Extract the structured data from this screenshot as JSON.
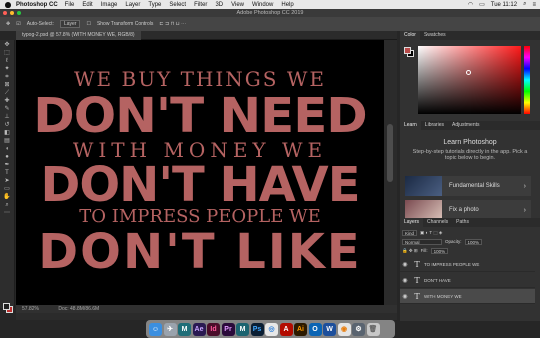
{
  "menubar": {
    "app": "Photoshop CC",
    "items": [
      "File",
      "Edit",
      "Image",
      "Layer",
      "Type",
      "Select",
      "Filter",
      "3D",
      "View",
      "Window",
      "Help"
    ],
    "time": "Tue 11:12"
  },
  "window": {
    "title": "Adobe Photoshop CC 2019"
  },
  "options": {
    "auto_select": "Auto-Select:",
    "layer_select": "Layer",
    "transform": "Show Transform Controls"
  },
  "document": {
    "tab": "typog-2.psd @ 57.8% (WITH MONEY WE, RGB/8)"
  },
  "artwork": {
    "lines": [
      "WE BUY THINGS WE",
      "DON'T NEED",
      "WITH MONEY WE",
      "DON'T HAVE",
      "TO IMPRESS PEOPLE WE",
      "DON'T LIKE"
    ],
    "text_color": "#b56362",
    "bg_color": "#000000"
  },
  "status": {
    "zoom": "57.82%",
    "doc": "Doc: 48.8M/86.6M"
  },
  "color_panel": {
    "tabs": [
      "Color",
      "Swatches"
    ],
    "fg": "#b84a49",
    "bg": "#000000"
  },
  "learn_panel": {
    "tabs": [
      "Learn",
      "Libraries",
      "Adjustments"
    ],
    "title": "Learn Photoshop",
    "desc": "Step-by-step tutorials directly in the app. Pick a topic below to begin.",
    "cards": [
      "Fundamental Skills",
      "Fix a photo"
    ]
  },
  "layers_panel": {
    "tabs": [
      "Layers",
      "Channels",
      "Paths"
    ],
    "kind": "Kind",
    "blend": "Normal",
    "opacity_label": "Opacity:",
    "opacity": "100%",
    "fill_label": "Fill:",
    "fill": "100%",
    "layers": [
      "TO IMPRESS PEOPLE WE",
      "DON'T HAVE",
      "WITH MONEY WE"
    ]
  },
  "dock": {
    "icons": [
      "finder-icon",
      "launchpad-icon",
      "muse-icon",
      "after-effects-icon",
      "indesign-icon",
      "premiere-icon",
      "muse-icon-2",
      "photoshop-icon",
      "safari-icon",
      "acrobat-icon",
      "illustrator-icon",
      "outlook-icon",
      "word-icon",
      "blender-icon",
      "utility-icon",
      "trash-icon"
    ]
  }
}
